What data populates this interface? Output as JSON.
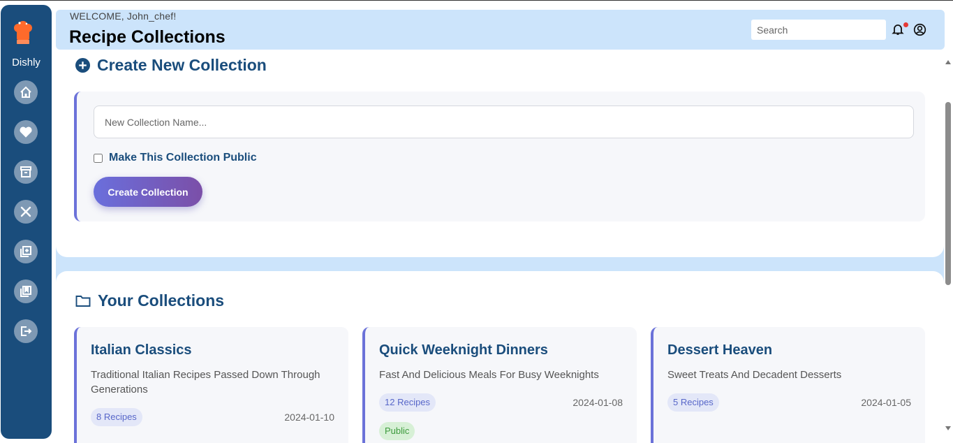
{
  "app": {
    "brand": "Dishly"
  },
  "header": {
    "welcome": "WELCOME, John_chef!",
    "title": "Recipe Collections",
    "search_placeholder": "Search"
  },
  "create_section": {
    "heading": "Create New Collection",
    "name_placeholder": "New Collection Name...",
    "public_label": "Make This Collection Public",
    "button_label": "Create Collection"
  },
  "collections_section": {
    "heading": "Your Collections",
    "items": [
      {
        "title": "Italian Classics",
        "description": "Traditional Italian Recipes Passed Down Through Generations",
        "recipes": "8 Recipes",
        "date": "2024-01-10"
      },
      {
        "title": "Quick Weeknight Dinners",
        "description": "Fast And Delicious Meals For Busy Weeknights",
        "recipes": "12 Recipes",
        "date": "2024-01-08",
        "visibility": "Public"
      },
      {
        "title": "Dessert Heaven",
        "description": "Sweet Treats And Decadent Desserts",
        "recipes": "5 Recipes",
        "date": "2024-01-05"
      }
    ]
  },
  "sidebar": {
    "icons": [
      "home-icon",
      "heart-icon",
      "archive-icon",
      "utensils-icon",
      "add-collection-icon",
      "collections-icon",
      "logout-icon"
    ]
  },
  "colors": {
    "primary": "#1a4d7c",
    "accent": "#6b72d9",
    "header_bg": "#cce4fb",
    "notification": "#e53935"
  }
}
